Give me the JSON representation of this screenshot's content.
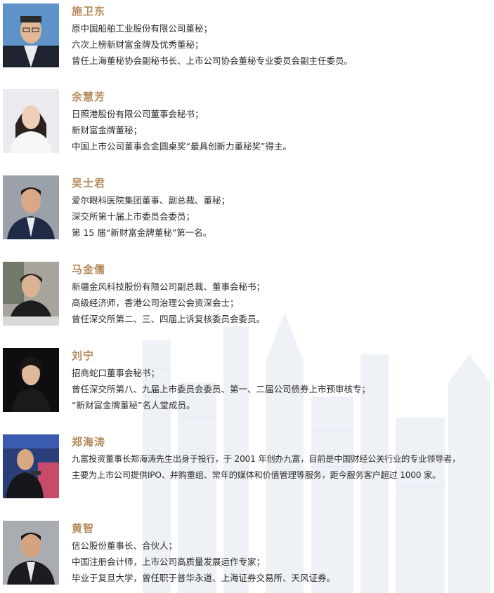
{
  "profiles": [
    {
      "name": "施卫东",
      "photo": "man-glasses-dark-suit-blue-background",
      "lines": [
        "原中国船舶工业股份有限公司董秘；",
        "六次上榜新财富金牌及优秀董秘；",
        "曾任上海董秘协会副秘书长、上市公司协会董秘专业委员会副主任委员。"
      ]
    },
    {
      "name": "余慧芳",
      "photo": "woman-white-blouse-light-background",
      "lines": [
        "日照港股份有限公司董事会秘书；",
        "新财富金牌董秘；",
        "中国上市公司董事会金圆桌奖“最具创新力董秘奖”得主。"
      ]
    },
    {
      "name": "吴士君",
      "photo": "man-navy-suit-grey-background",
      "lines": [
        "爱尔眼科医院集团董事、副总裁、董秘；",
        "深交所第十届上市委员会委员；",
        "第 15 届“新财富金牌董秘”第一名。"
      ]
    },
    {
      "name": "马金儒",
      "photo": "woman-dark-jacket-office-background",
      "lines": [
        "新疆金风科技股份有限公司副总裁、董事会秘书；",
        "高级经济师，香港公司治理公会资深会士；",
        "曾任深交所第二、三、四届上诉复核委员会委员。"
      ]
    },
    {
      "name": "刘宁",
      "photo": "woman-black-background",
      "lines": [
        "招商蛇口董事会秘书；",
        "曾任深交所第八、九届上市委员会委员、第一、二届公司债券上市预审核专；",
        "“新财富金牌董秘”名人堂成员。"
      ]
    },
    {
      "name": "郑海涛",
      "photo": "man-speaking-at-podium-stage",
      "lines": [
        "九富投资董事长郑海涛先生出身于投行，于 2001 年创办九富，目前是中国财经公关行业的专业领导者，",
        "主要为上市公司提供IPO、并购重组、常年的媒体和价值管理等服务，距今服务客户超过 1000 家。"
      ]
    },
    {
      "name": "黄智",
      "photo": "man-dark-suit-grey-background",
      "lines": [
        "信公股份董事长、合伙人；",
        "中国注册会计师，上市公司高质量发展运作专家；",
        "毕业于复旦大学，曾任职于普华永道、上海证券交易所、天风证券。"
      ]
    }
  ],
  "colors": {
    "name": "#b5895b",
    "text": "#2a2a2a"
  }
}
